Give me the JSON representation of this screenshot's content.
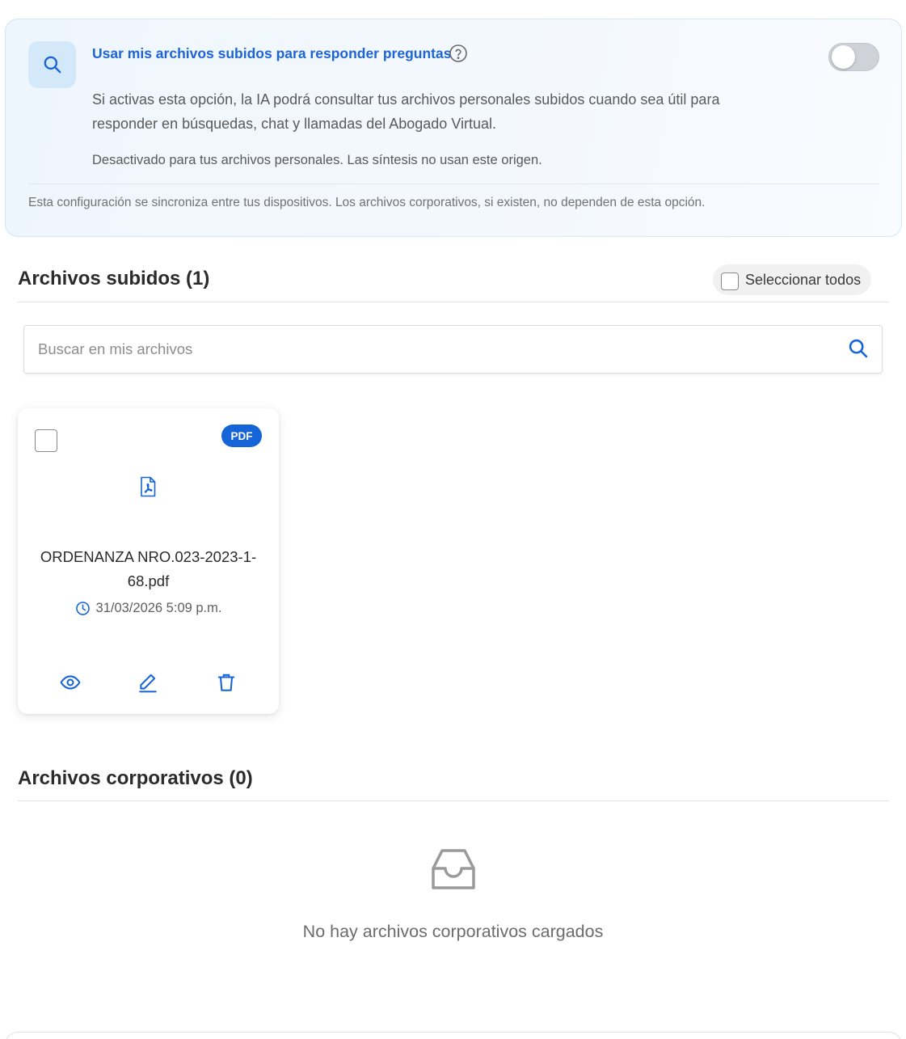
{
  "settings": {
    "title": "Usar mis archivos subidos para responder preguntas",
    "description": "Si activas esta opción, la IA podrá consultar tus archivos personales subidos cuando sea útil para responder en búsquedas, chat y llamadas del Abogado Virtual.",
    "status": "Desactivado para tus archivos personales. Las síntesis no usan este origen.",
    "note": "Esta configuración se sincroniza entre tus dispositivos. Los archivos corporativos, si existen, no dependen de esta opción.",
    "toggle_enabled": false
  },
  "uploaded": {
    "title": "Archivos subidos (1)",
    "select_all_label": "Seleccionar todos",
    "search_placeholder": "Buscar en mis archivos",
    "files": [
      {
        "badge": "PDF",
        "name": "ORDENANZA NRO.023-2023-1-68.pdf",
        "date": "31/03/2026 5:09 p.m."
      }
    ]
  },
  "corporate": {
    "title": "Archivos corporativos (0)",
    "empty_message": "No hay archivos corporativos cargados"
  },
  "colors": {
    "accent": "#1565d8",
    "title_blue": "#1d64d6",
    "card_bg": "#eef6fd",
    "toggle_off": "#cfd3d9"
  },
  "icons": {
    "settings": "search-icon",
    "help": "help-circle-icon",
    "search": "search-icon",
    "file_type": "pdf-file-icon",
    "date": "clock-icon",
    "view": "eye-icon",
    "edit": "pencil-icon",
    "delete": "trash-icon",
    "empty": "inbox-icon"
  }
}
